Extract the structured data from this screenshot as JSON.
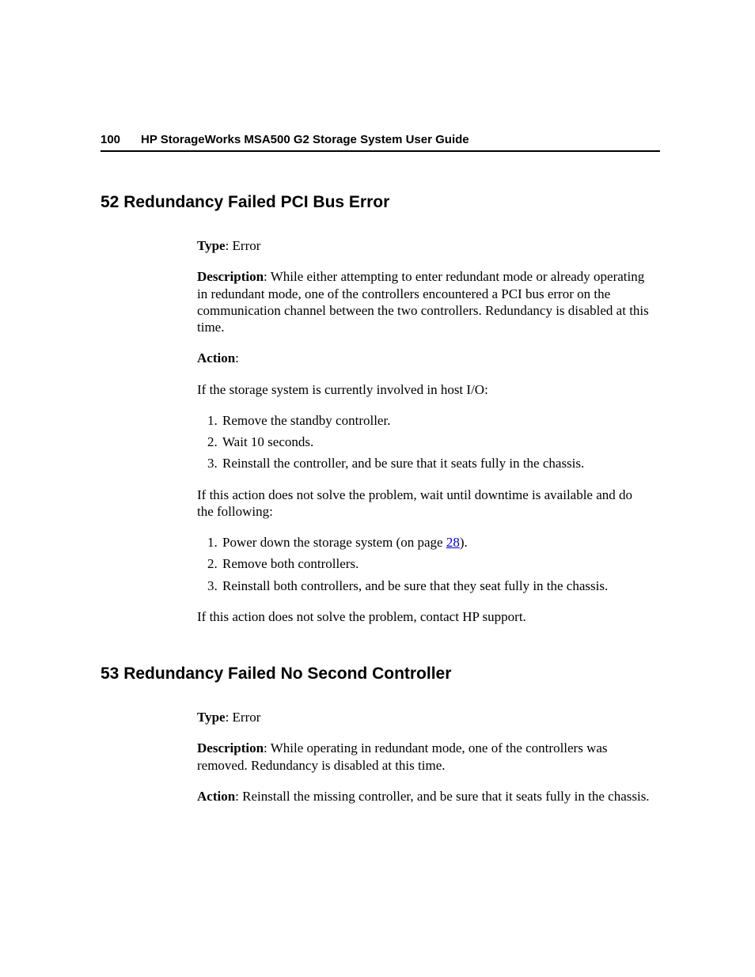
{
  "header": {
    "page_number": "100",
    "title": "HP StorageWorks MSA500 G2 Storage System User Guide"
  },
  "section1": {
    "heading": "52 Redundancy Failed PCI Bus Error",
    "type_label": "Type",
    "type_value": ": Error",
    "desc_label": "Description",
    "desc_value": ": While either attempting to enter redundant mode or already operating in redundant mode, one of the controllers encountered a PCI bus error on the communication channel between the two controllers. Redundancy is disabled at this time.",
    "action_label": "Action",
    "action_colon": ":",
    "action_intro": "If the storage system is currently involved in host I/O:",
    "list1": {
      "i1": "Remove the standby controller.",
      "i2": "Wait 10 seconds.",
      "i3": "Reinstall the controller, and be sure that it seats fully in the chassis."
    },
    "mid_para": "If this action does not solve the problem, wait until downtime is available and do the following:",
    "list2": {
      "i1_pre": "Power down the storage system (on page ",
      "i1_link": "28",
      "i1_post": ").",
      "i2": "Remove both controllers.",
      "i3": "Reinstall both controllers, and be sure that they seat fully in the chassis."
    },
    "closing": "If this action does not solve the problem, contact HP support."
  },
  "section2": {
    "heading": "53 Redundancy Failed No Second Controller",
    "type_label": "Type",
    "type_value": ": Error",
    "desc_label": "Description",
    "desc_value": ": While operating in redundant mode, one of the controllers was removed. Redundancy is disabled at this time.",
    "action_label": "Action",
    "action_value": ": Reinstall the missing controller, and be sure that it seats fully in the chassis."
  }
}
